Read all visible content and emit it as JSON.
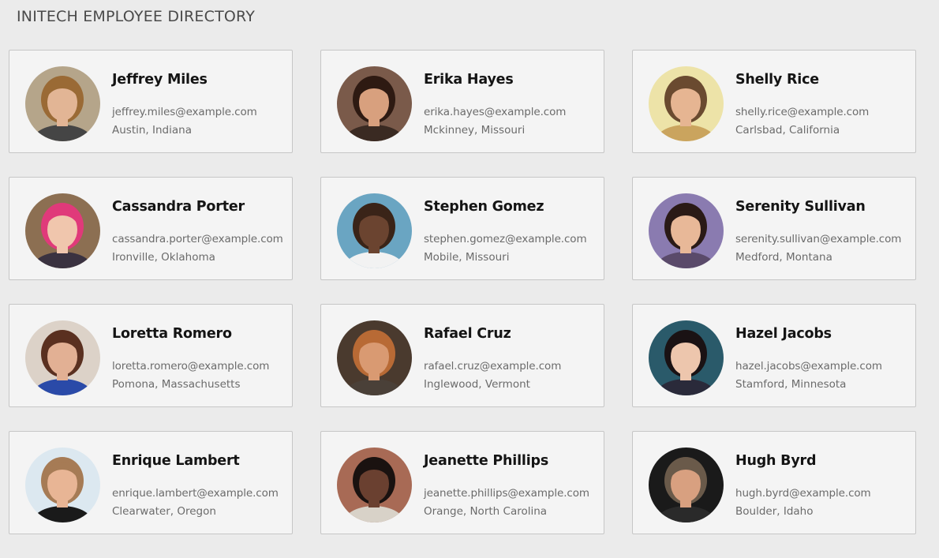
{
  "header": {
    "title": "INITECH EMPLOYEE DIRECTORY"
  },
  "employees": [
    {
      "name": "Jeffrey Miles",
      "email": "jeffrey.miles@example.com",
      "location": "Austin, Indiana",
      "photo": {
        "bg": "#b5a58a",
        "skin": "#e2b595",
        "hair": "#9a6a35",
        "shirt": "#454545"
      }
    },
    {
      "name": "Erika Hayes",
      "email": "erika.hayes@example.com",
      "location": "Mckinney, Missouri",
      "photo": {
        "bg": "#7a5a4a",
        "skin": "#d8a07e",
        "hair": "#2e1a12",
        "shirt": "#3a2a22"
      }
    },
    {
      "name": "Shelly Rice",
      "email": "shelly.rice@example.com",
      "location": "Carlsbad, California",
      "photo": {
        "bg": "#ede3a8",
        "skin": "#e6b592",
        "hair": "#6a4a30",
        "shirt": "#caa45e"
      }
    },
    {
      "name": "Cassandra Porter",
      "email": "cassandra.porter@example.com",
      "location": "Ironville, Oklahoma",
      "photo": {
        "bg": "#8c6f52",
        "skin": "#f0c6ad",
        "hair": "#e03a7a",
        "shirt": "#3a3240"
      }
    },
    {
      "name": "Stephen Gomez",
      "email": "stephen.gomez@example.com",
      "location": "Mobile, Missouri",
      "photo": {
        "bg": "#6aa5c2",
        "skin": "#6b4430",
        "hair": "#3a2418",
        "shirt": "#f2f2f2"
      }
    },
    {
      "name": "Serenity Sullivan",
      "email": "serenity.sullivan@example.com",
      "location": "Medford, Montana",
      "photo": {
        "bg": "#8a7bb0",
        "skin": "#e8b898",
        "hair": "#2a1a16",
        "shirt": "#5a4a6a"
      }
    },
    {
      "name": "Loretta Romero",
      "email": "loretta.romero@example.com",
      "location": "Pomona, Massachusetts",
      "photo": {
        "bg": "#dcd2c8",
        "skin": "#e2b094",
        "hair": "#5a3020",
        "shirt": "#2a4aa8"
      }
    },
    {
      "name": "Rafael Cruz",
      "email": "rafael.cruz@example.com",
      "location": "Inglewood, Vermont",
      "photo": {
        "bg": "#4a3a2e",
        "skin": "#d99a72",
        "hair": "#b86a35",
        "shirt": "#4a4038"
      }
    },
    {
      "name": "Hazel Jacobs",
      "email": "hazel.jacobs@example.com",
      "location": "Stamford, Minnesota",
      "photo": {
        "bg": "#2a5a6a",
        "skin": "#edc6ad",
        "hair": "#1a1214",
        "shirt": "#2a2a3a"
      }
    },
    {
      "name": "Enrique Lambert",
      "email": "enrique.lambert@example.com",
      "location": "Clearwater, Oregon",
      "photo": {
        "bg": "#dce8f0",
        "skin": "#e8b595",
        "hair": "#a67b55",
        "shirt": "#1a1a1a"
      }
    },
    {
      "name": "Jeanette Phillips",
      "email": "jeanette.phillips@example.com",
      "location": "Orange, North Carolina",
      "photo": {
        "bg": "#a86a55",
        "skin": "#6a4030",
        "hair": "#1a1210",
        "shirt": "#d8d2c8"
      }
    },
    {
      "name": "Hugh Byrd",
      "email": "hugh.byrd@example.com",
      "location": "Boulder, Idaho",
      "photo": {
        "bg": "#1a1a1a",
        "skin": "#d8a080",
        "hair": "#6a5a4a",
        "shirt": "#2a2a2a"
      }
    }
  ]
}
